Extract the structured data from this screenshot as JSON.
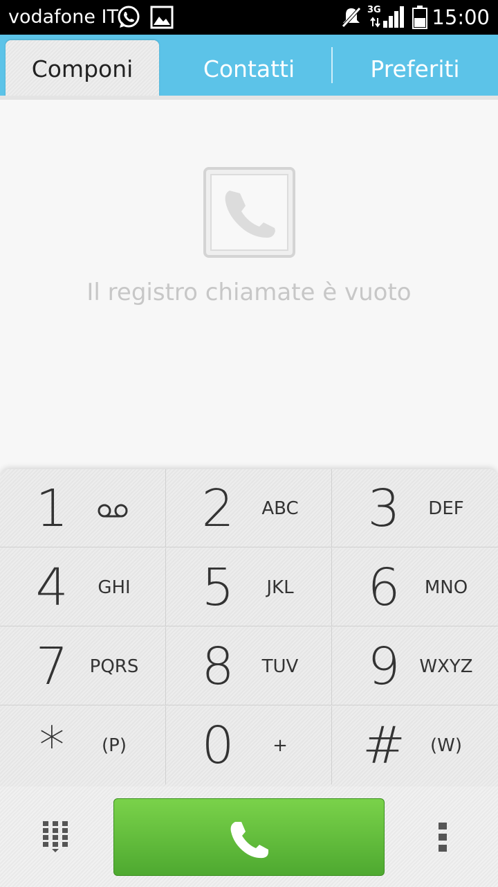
{
  "statusbar": {
    "carrier": "vodafone IT",
    "network": "3G",
    "time": "15:00",
    "icons": [
      "whatsapp-icon",
      "image-icon",
      "mute-icon",
      "signal-icon",
      "battery-icon"
    ]
  },
  "tabs": [
    {
      "label": "Componi",
      "active": true
    },
    {
      "label": "Contatti",
      "active": false
    },
    {
      "label": "Preferiti",
      "active": false
    }
  ],
  "empty_state": {
    "icon": "phone-icon",
    "text": "Il registro chiamate è vuoto"
  },
  "keypad": {
    "keys": [
      {
        "digit": "1",
        "letters": "",
        "sub_icon": "voicemail-icon"
      },
      {
        "digit": "2",
        "letters": "ABC"
      },
      {
        "digit": "3",
        "letters": "DEF"
      },
      {
        "digit": "4",
        "letters": "GHI"
      },
      {
        "digit": "5",
        "letters": "JKL"
      },
      {
        "digit": "6",
        "letters": "MNO"
      },
      {
        "digit": "7",
        "letters": "PQRS"
      },
      {
        "digit": "8",
        "letters": "TUV"
      },
      {
        "digit": "9",
        "letters": "WXYZ"
      },
      {
        "digit": "*",
        "letters": "(P)"
      },
      {
        "digit": "0",
        "letters": "+"
      },
      {
        "digit": "#",
        "letters": "(W)"
      }
    ]
  },
  "bottombar": {
    "left_icon": "dialpad-icon",
    "call_icon": "call-icon",
    "right_icon": "overflow-menu-icon"
  },
  "colors": {
    "tab_bar": "#5cc3e8",
    "call_button": "#62bd3c",
    "statusbar": "#000000"
  }
}
